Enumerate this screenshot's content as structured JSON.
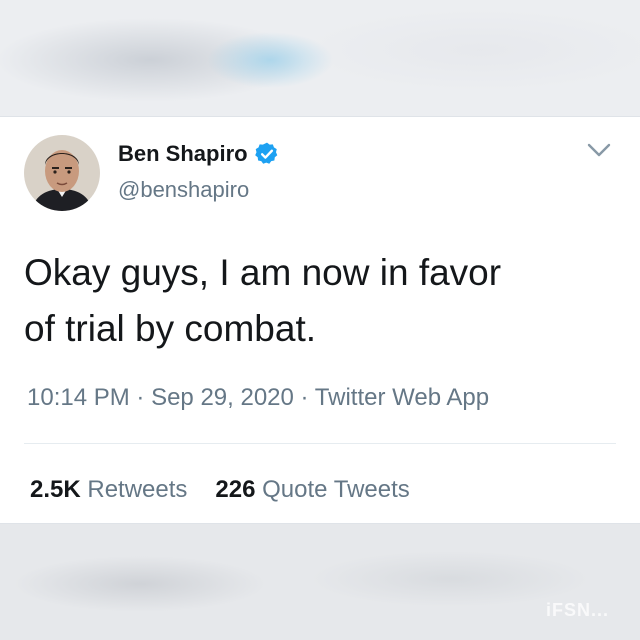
{
  "tweet": {
    "author_name": "Ben Shapiro",
    "author_handle": "@benshapiro",
    "verified": true,
    "text_line1": "Okay guys, I am now in favor",
    "text_line2": "of trial by combat.",
    "time": "10:14 PM",
    "date": "Sep 29, 2020",
    "client": "Twitter Web App",
    "separator": "·",
    "retweets_count": "2.5K",
    "retweets_label": "Retweets",
    "quotes_count": "226",
    "quotes_label": "Quote Tweets"
  },
  "watermark": "iFSN...",
  "colors": {
    "verified_blue": "#1da1f2",
    "text_primary": "#14171a",
    "text_secondary": "#657786"
  }
}
